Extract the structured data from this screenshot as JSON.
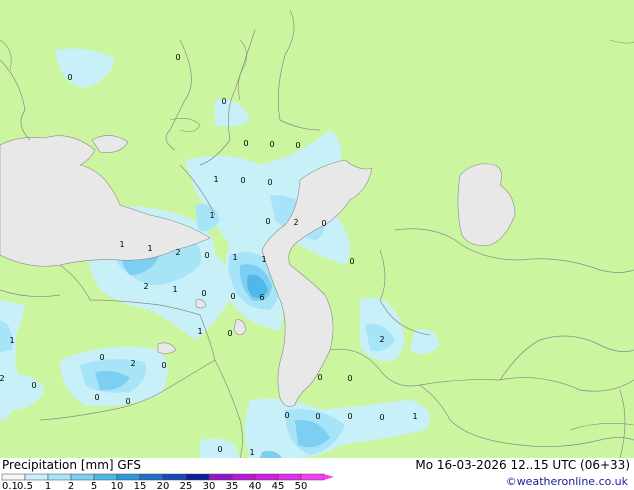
{
  "footer": {
    "title": "Precipitation [mm]  GFS",
    "datetime": "Mo 16-03-2026 12..15 UTC (06+33)",
    "credit": "©weatheronline.co.uk"
  },
  "legend": {
    "ticks": [
      "0.1",
      "0.5",
      "1",
      "2",
      "5",
      "10",
      "15",
      "20",
      "25",
      "30",
      "35",
      "40",
      "45",
      "50"
    ],
    "colors": [
      "#f5f5f5",
      "#c8f0f8",
      "#a8e4f8",
      "#7ccff0",
      "#4fb8e8",
      "#2c98d8",
      "#1f6fc8",
      "#1a48b4",
      "#0f1f98",
      "#9016c8",
      "#b81ad8",
      "#d020e0",
      "#e030e8",
      "#f040f0"
    ]
  },
  "colors": {
    "land": "#ccf5a0",
    "water": "#e8e8e8",
    "border": "#8a8a8a",
    "precip_light": "#c8f0f8",
    "precip_mid": "#a8e4f8",
    "precip_heavy": "#7ccff0",
    "precip_max": "#4fb8e8"
  },
  "map_labels": [
    {
      "text": "0"
    },
    {
      "text": "0"
    },
    {
      "text": "0"
    },
    {
      "text": "0"
    },
    {
      "text": "0"
    },
    {
      "text": "0"
    },
    {
      "text": "1"
    },
    {
      "text": "0"
    },
    {
      "text": "0"
    },
    {
      "text": "1"
    },
    {
      "text": "0"
    },
    {
      "text": "2"
    },
    {
      "text": "0"
    },
    {
      "text": "1"
    },
    {
      "text": "1"
    },
    {
      "text": "2"
    },
    {
      "text": "0"
    },
    {
      "text": "1"
    },
    {
      "text": "1"
    },
    {
      "text": "2"
    },
    {
      "text": "1"
    },
    {
      "text": "0"
    },
    {
      "text": "0"
    },
    {
      "text": "6"
    },
    {
      "text": "0"
    },
    {
      "text": "1"
    },
    {
      "text": "0"
    },
    {
      "text": "1"
    },
    {
      "text": "0"
    },
    {
      "text": "2"
    },
    {
      "text": "0"
    },
    {
      "text": "2"
    },
    {
      "text": "0"
    },
    {
      "text": "0"
    },
    {
      "text": "0"
    },
    {
      "text": "0"
    },
    {
      "text": "0"
    },
    {
      "text": "0"
    },
    {
      "text": "0"
    },
    {
      "text": "0"
    },
    {
      "text": "1"
    },
    {
      "text": "0"
    },
    {
      "text": "1"
    },
    {
      "text": "2"
    },
    {
      "text": "0"
    }
  ]
}
